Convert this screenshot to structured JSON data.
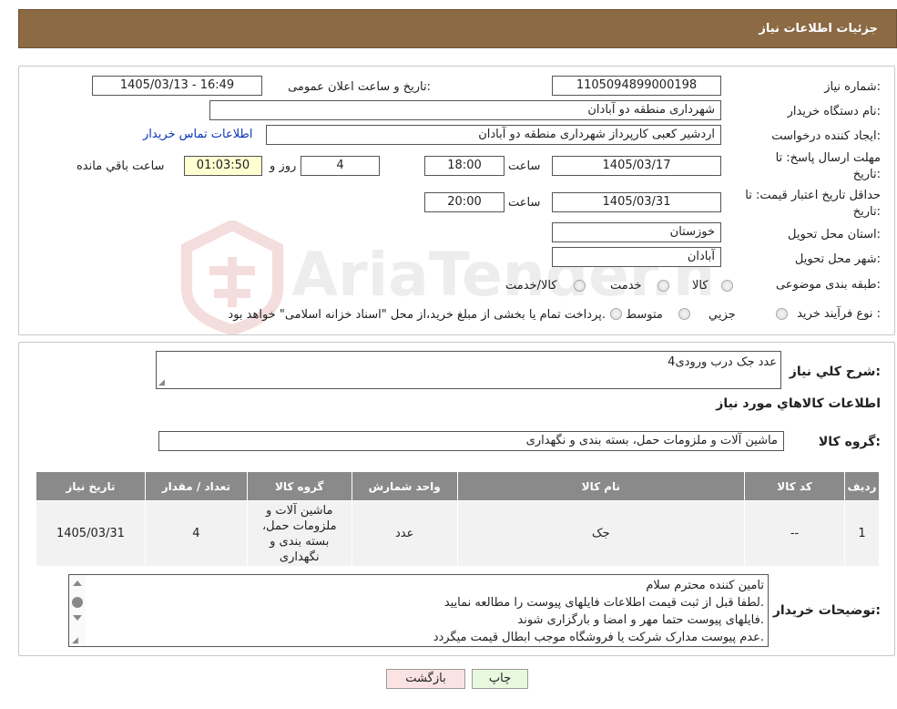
{
  "header": {
    "title": "جزئیات اطلاعات نیاز"
  },
  "form": {
    "need_number_label": "شماره نیاز:",
    "need_number": "1105094899000198",
    "announce_label": "تاریخ و ساعت اعلان عمومی:",
    "announce_value": "1405/03/13 - 16:49",
    "buyer_label": "نام دستگاه خریدار:",
    "buyer_value": "شهرداری منطقه دو آبادان",
    "creator_label": "ایجاد کننده درخواست:",
    "creator_value": "اردشیر کعبی کارپرداز شهرداری منطقه دو آبادان",
    "contact_link": "اطلاعات تماس خریدار",
    "deadline_label_1": "مهلت ارسال پاسخ: تا",
    "deadline_label_2": "تاریخ:",
    "deadline_date": "1405/03/17",
    "time_label": "ساعت",
    "deadline_time": "18:00",
    "days_value": "4",
    "days_label": "روز و",
    "remaining_time": "01:03:50",
    "remaining_label": "ساعت باقي مانده",
    "validity_label_1": "حداقل تاریخ اعتبار قیمت: تا",
    "validity_label_2": "تاریخ:",
    "validity_date": "1405/03/31",
    "validity_time_label": "ساعت",
    "validity_time": "20:00",
    "province_label": "استان محل تحویل:",
    "province_value": "خوزستان",
    "city_label": "شهر محل تحویل:",
    "city_value": "آبادان",
    "category_label": "طبقه بندی موضوعی:",
    "category_options": [
      "کالا",
      "خدمت",
      "کالا/خدمت"
    ],
    "process_label": "نوع فرآیند خرید :",
    "process_options": [
      "جزيي",
      "متوسط"
    ],
    "process_note": "پرداخت تمام یا بخشی از مبلغ خرید،از محل \"اسناد خزانه اسلامی\" خواهد بود."
  },
  "description": {
    "label": "شرح کلي نياز:",
    "value": "4عدد جک درب ورودی"
  },
  "goods": {
    "section_title": "اطلاعات کالاهاي مورد نياز",
    "group_label": "گروه کالا:",
    "group_value": "ماشین آلات و ملزومات حمل، بسته بندی و نگهداری",
    "columns": [
      "رديف",
      "کد کالا",
      "نام کالا",
      "واحد شمارش",
      "گروه کالا",
      "تعداد / مقدار",
      "تاریخ نیاز"
    ],
    "rows": [
      {
        "row": "1",
        "code": "--",
        "name": "جک",
        "unit": "عدد",
        "group": "ماشین آلات و ملزومات حمل، بسته بندی و نگهداری",
        "qty": "4",
        "date": "1405/03/31"
      }
    ]
  },
  "notes": {
    "label": "توضیحات خریدار:",
    "lines": [
      "تامین کننده محترم سلام",
      "لطفا قبل از ثبت قیمت اطلاعات فایلهای پیوست را مطالعه نمایید.",
      "فایلهای پیوست حتما مهر و امضا و بارگزاری شوند.",
      "عدم پیوست مدارک شرکت یا فروشگاه موجب ابطال قیمت میگردد."
    ]
  },
  "buttons": {
    "print": "چاپ",
    "back": "بازگشت"
  },
  "colors": {
    "header_bg": "#8b6a44",
    "table_header": "#8a8a8a",
    "print_btn": "#e8f8df",
    "back_btn": "#fbe3e3"
  }
}
